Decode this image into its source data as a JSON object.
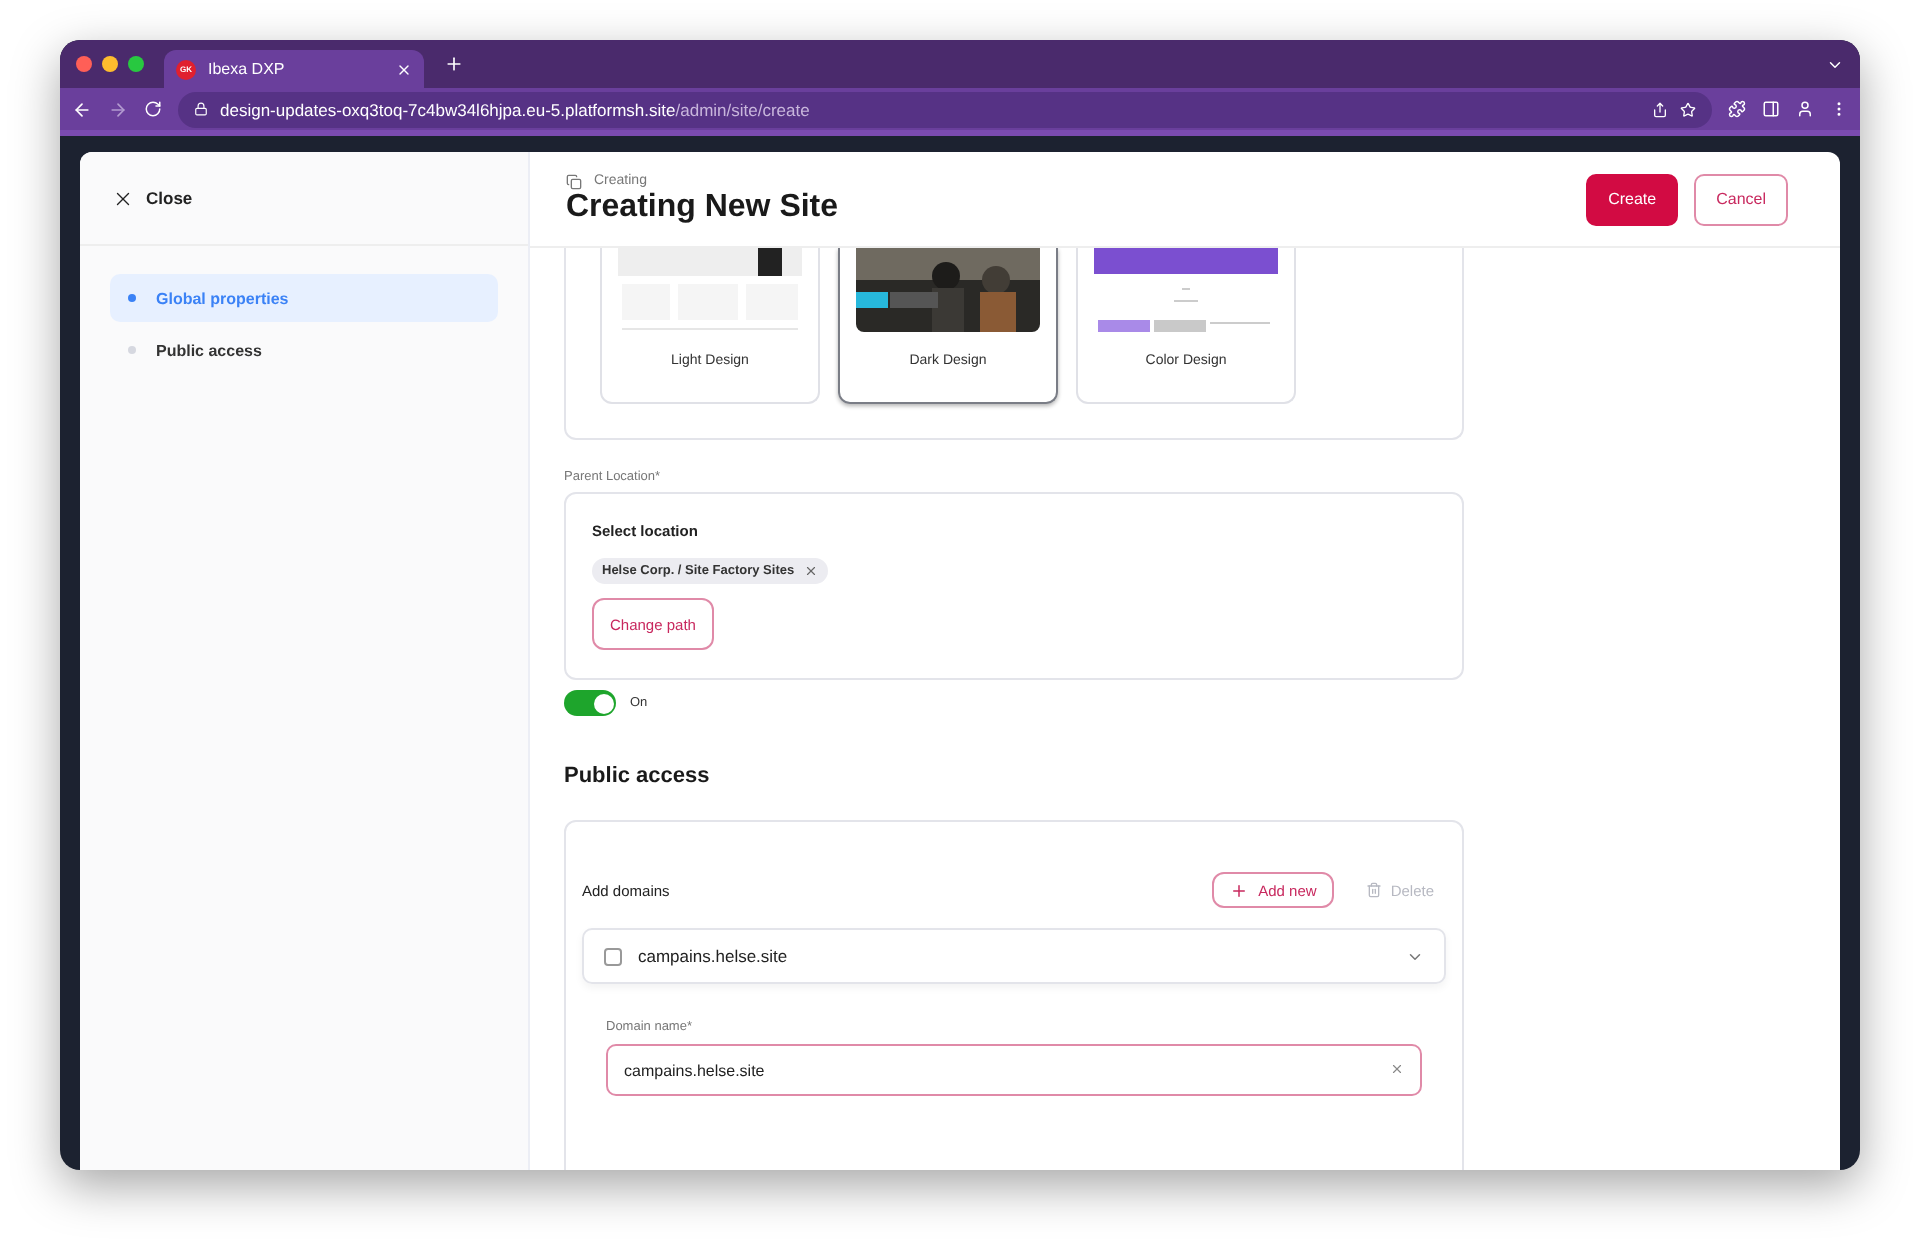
{
  "browser": {
    "tab_title": "Ibexa DXP",
    "tab_logo": "GK",
    "url_host": "design-updates-oxq3toq-7c4bw34l6hjpa.eu-5.platformsh.site",
    "url_path": "/admin/site/create"
  },
  "sidebar": {
    "close_label": "Close",
    "items": [
      {
        "label": "Global properties",
        "selected": true
      },
      {
        "label": "Public access",
        "selected": false
      }
    ]
  },
  "header": {
    "breadcrumb": "Creating",
    "title": "Creating New Site",
    "buttons": [
      {
        "label": "Create",
        "kind": "primary"
      },
      {
        "label": "Cancel",
        "kind": "secondary"
      }
    ]
  },
  "designs": [
    {
      "label": "Light Design",
      "selected": false,
      "kind": "light"
    },
    {
      "label": "Dark Design",
      "selected": true,
      "kind": "dark"
    },
    {
      "label": "Color Design",
      "selected": false,
      "kind": "color"
    }
  ],
  "parent_location": {
    "label": "Parent Location*",
    "select_label": "Select location",
    "tag": "Helse Corp. / Site Factory Sites",
    "button": "Change path"
  },
  "toggle": {
    "on": true,
    "label": "On"
  },
  "public_access": {
    "heading": "Public access",
    "add_domains_label": "Add domains",
    "add_button": "Add new",
    "delete_button": {
      "label": "Delete",
      "disabled": true
    },
    "domains": [
      {
        "name": "campains.helse.site",
        "checked": false,
        "expanded": true,
        "field_label": "Domain name*",
        "value": "campains.helse.site"
      }
    ]
  }
}
